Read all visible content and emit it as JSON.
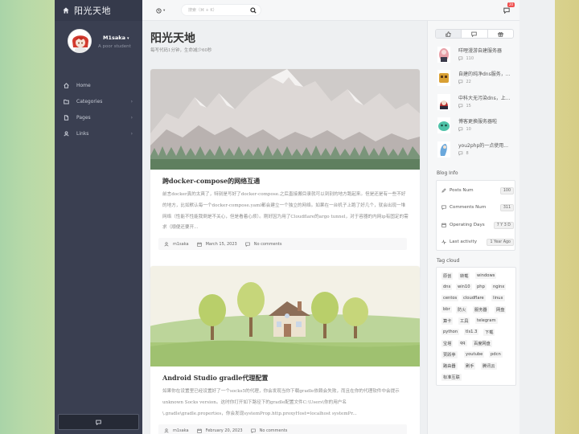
{
  "site": {
    "title": "阳光天地"
  },
  "user": {
    "name": "M1saka",
    "subtitle": "A poor student"
  },
  "nav": [
    {
      "label": "Home",
      "icon": "home-icon"
    },
    {
      "label": "Categories",
      "icon": "folder-icon"
    },
    {
      "label": "Pages",
      "icon": "file-icon"
    },
    {
      "label": "Links",
      "icon": "user-icon"
    }
  ],
  "search": {
    "placeholder": "搜索（⌘ + K）"
  },
  "notifications": {
    "count": "20"
  },
  "page": {
    "title": "阳光天地",
    "subtitle": "每写代码1分钟，生命减少60秒"
  },
  "posts": [
    {
      "title": "跨docker-compose的网络互通",
      "excerpt": "前言docker真的太爽了，特别是写好了docker-compose.之后直接搬目录就可以到别的地方跑起来。但是还是有一些不好的地方，比如默认每一个docker-compose.yaml都会建立一个独立的网络。如果在一台机子上跑了好几个，就会出现一堆网络（性能不性能我倒是不关心，但是看着心烦）。刚好因为用了Cloudflare的argo tunnel，对于容器的内网ip有固定的需求（顺便还要开...",
      "author": "m1saka",
      "date": "March 15, 2023",
      "comments": "No comments"
    },
    {
      "title": "Android Studio gradle代理配置",
      "excerpt": "如果你在设置里已经设置好了一个socks5的代理，你会发现当你下载gradle依赖会失败，而且在你的代理软件中会提示unknown Socks version。这时你打开如下路径下的gradle配置文件C:\\Users\\你的用户名\\.gradle\\gradle.properties，你会发现systemProp.http.proxyHost=localhost systemPr...",
      "author": "m1saka",
      "date": "February 20, 2023",
      "comments": "No comments"
    }
  ],
  "recent_posts": [
    {
      "title": "咩哩漫游自建服务器",
      "count": "110"
    },
    {
      "title": "自建的纯净dns服务，...",
      "count": "22"
    },
    {
      "title": "中科大无污染dns，上...",
      "count": "15"
    },
    {
      "title": "博客更换服务器啦",
      "count": "10"
    },
    {
      "title": "you2php的一点使用...",
      "count": "8"
    }
  ],
  "blog_info": {
    "label": "Blog Info",
    "rows": [
      {
        "label": "Posts Num",
        "value": "100",
        "icon": "pencil-icon"
      },
      {
        "label": "Comments Num",
        "value": "311",
        "icon": "comment-icon"
      },
      {
        "label": "Operating Days",
        "value": "7 Y 3 D",
        "icon": "calendar-icon"
      },
      {
        "label": "Last activity",
        "value": "1 Year Ago",
        "icon": "activity-icon"
      }
    ]
  },
  "tag_cloud": {
    "label": "Tag cloud",
    "tags": [
      "原创",
      "转载",
      "windows",
      "dns",
      "win10",
      "php",
      "nginx",
      "centos",
      "cloudflare",
      "linux",
      "bbr",
      "防火",
      "服务器",
      "网盘",
      "算卡",
      "工具",
      "telegram",
      "python",
      "tls1.3",
      "下载",
      "宝塔",
      "qq",
      "百度网盘",
      "贾跃亭",
      "youtube",
      "pdcn",
      "路由器",
      "刷手",
      "腾讯云",
      "标准互联"
    ]
  },
  "colors": {
    "sidebar": "#3a3f51",
    "accent": "#f05050",
    "background": "#eef0f2"
  }
}
